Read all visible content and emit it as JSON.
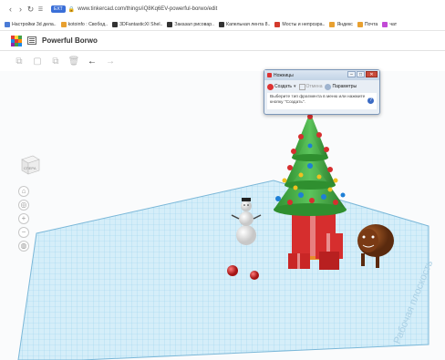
{
  "browser": {
    "url": "www.tinkercad.com/things/iQ8Kq6EV-powerful-borwo/edit",
    "security_badge": "EXT",
    "bookmarks": [
      {
        "label": "Настройки 3d дела..",
        "color": "#4a7bd6"
      },
      {
        "label": "kotoinfo : Свобод..",
        "color": "#e8a030"
      },
      {
        "label": "3DFantasticXI Shel..",
        "color": "#333333"
      },
      {
        "label": "Заказал рисовар..",
        "color": "#333333"
      },
      {
        "label": "Капельная лента 8..",
        "color": "#333333"
      },
      {
        "label": "Мосты и непрозра..",
        "color": "#d33a2c"
      },
      {
        "label": "Яндекс",
        "color": "#e8a030"
      },
      {
        "label": "Почта",
        "color": "#e8a030"
      },
      {
        "label": "чат",
        "color": "#c24ad6"
      }
    ]
  },
  "app": {
    "title": "Powerful Borwo",
    "logo_colors": [
      "#e53935",
      "#fdd835",
      "#43a047",
      "#1e88e5",
      "#e53935",
      "#fb8c00",
      "#8e24aa",
      "#43a047",
      "#1e88e5"
    ]
  },
  "toolbar": {
    "buttons": [
      {
        "name": "copy-icon",
        "glyph": "⧉"
      },
      {
        "name": "paste-icon",
        "glyph": "▢"
      },
      {
        "name": "duplicate-icon",
        "glyph": "⧉"
      },
      {
        "name": "delete-icon",
        "glyph": "🗑"
      },
      {
        "name": "undo-icon",
        "glyph": "←"
      },
      {
        "name": "redo-icon",
        "glyph": "→"
      }
    ]
  },
  "viewcube": {
    "label": "СПЕРА"
  },
  "side_controls": [
    {
      "name": "home-view-icon",
      "glyph": "⌂"
    },
    {
      "name": "fit-view-icon",
      "glyph": "◎"
    },
    {
      "name": "zoom-in-icon",
      "glyph": "+"
    },
    {
      "name": "zoom-out-icon",
      "glyph": "−"
    },
    {
      "name": "ortho-view-icon",
      "glyph": "◍"
    }
  ],
  "workplane": {
    "label": "Рабочая плоскость"
  },
  "snip_dialog": {
    "title": "Ножницы",
    "create_label": "Создать",
    "cancel_label": "Отмена",
    "options_label": "Параметры",
    "message": "Выберите тип фрагмента в меню или нажмите кнопку \"Создать\".",
    "help": "?"
  },
  "colors": {
    "grid": "#7ec3e6",
    "grid_bg": "#cfeaf7",
    "tree": "#3fa33f",
    "gift": "#d62e2e"
  }
}
